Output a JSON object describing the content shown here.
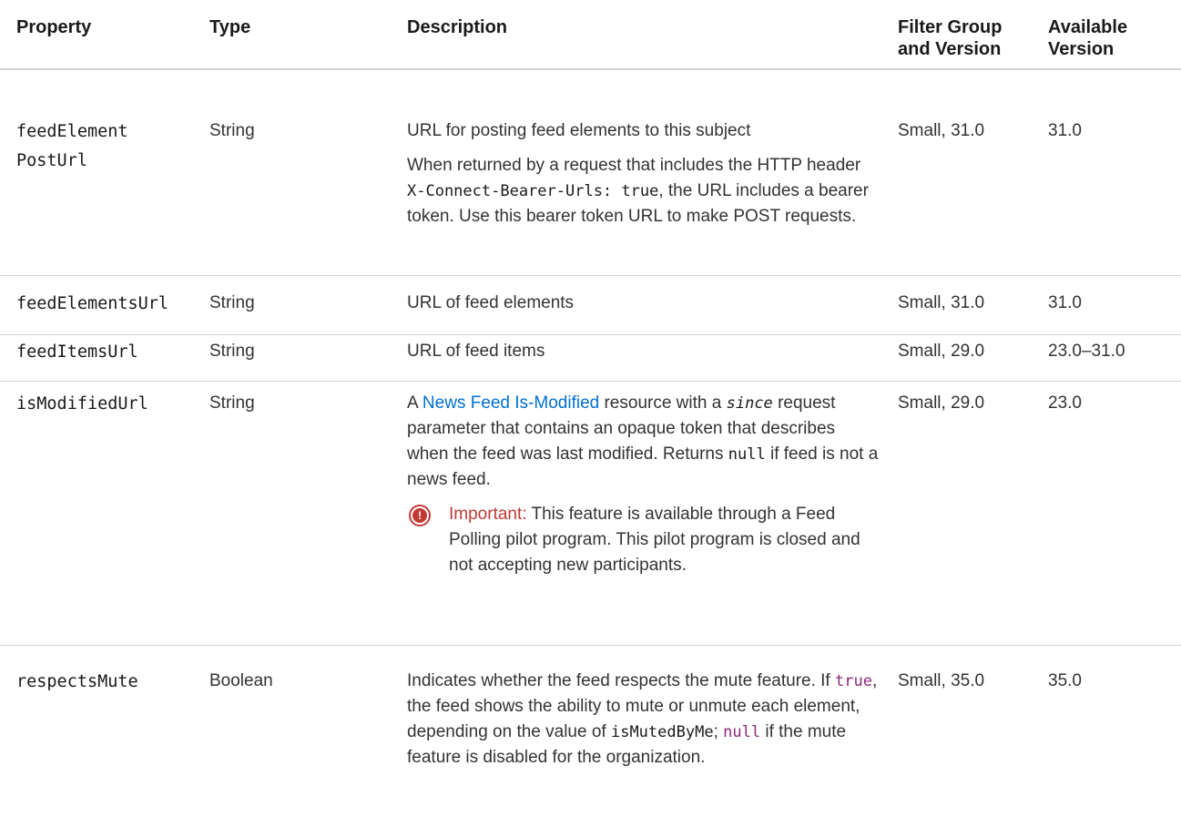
{
  "headers": {
    "property": "Property",
    "type": "Type",
    "description": "Description",
    "filter_line1": "Filter Group",
    "filter_line2": "and Version",
    "available_line1": "Available",
    "available_line2": "Version"
  },
  "rows": [
    {
      "property_line1": "feedElement",
      "property_line2": "PostUrl",
      "type": "String",
      "desc_p1": "URL for posting feed elements to this subject",
      "desc_p2_a": "When returned by a request that includes the HTTP header ",
      "desc_p2_code": "X-Connect-Bearer-Urls: true",
      "desc_p2_b": ", the URL includes a bearer token. Use this bearer token URL to make POST requests.",
      "filter": "Small, 31.0",
      "available": "31.0"
    },
    {
      "property": "feedElementsUrl",
      "type": "String",
      "desc": "URL of feed elements",
      "filter": "Small, 31.0",
      "available": "31.0"
    },
    {
      "property": "feedItemsUrl",
      "type": "String",
      "desc": "URL of feed items",
      "filter": "Small, 29.0",
      "available": "23.0–31.0"
    },
    {
      "property": "isModifiedUrl",
      "type": "String",
      "desc_a": "A ",
      "desc_link": "News Feed Is-Modified",
      "desc_b": " resource with a ",
      "desc_italic": "since",
      "desc_c": " request parameter that contains an opaque token that describes when the feed was last modified. Returns ",
      "desc_code": "null",
      "desc_d": " if feed is not a news feed.",
      "important_label": "Important:",
      "important_text": " This feature is available through a Feed Polling pilot program. This pilot program is closed and not accepting new participants.",
      "filter": "Small, 29.0",
      "available": "23.0"
    },
    {
      "property": "respectsMute",
      "type": "Boolean",
      "desc_a": "Indicates whether the feed respects the mute feature. If ",
      "desc_code1": "true",
      "desc_b": ", the feed shows the ability to mute or unmute each element, depending on the value of ",
      "desc_code2": "isMutedByMe",
      "desc_c": "; ",
      "desc_code3": "null",
      "desc_d": " if the mute feature is disabled for the organization.",
      "filter": "Small, 35.0",
      "available": "35.0"
    }
  ],
  "colors": {
    "link": "#0070d2",
    "important": "#c23934",
    "code_highlight": "#8a2a77",
    "rule": "#d4d4d4"
  }
}
